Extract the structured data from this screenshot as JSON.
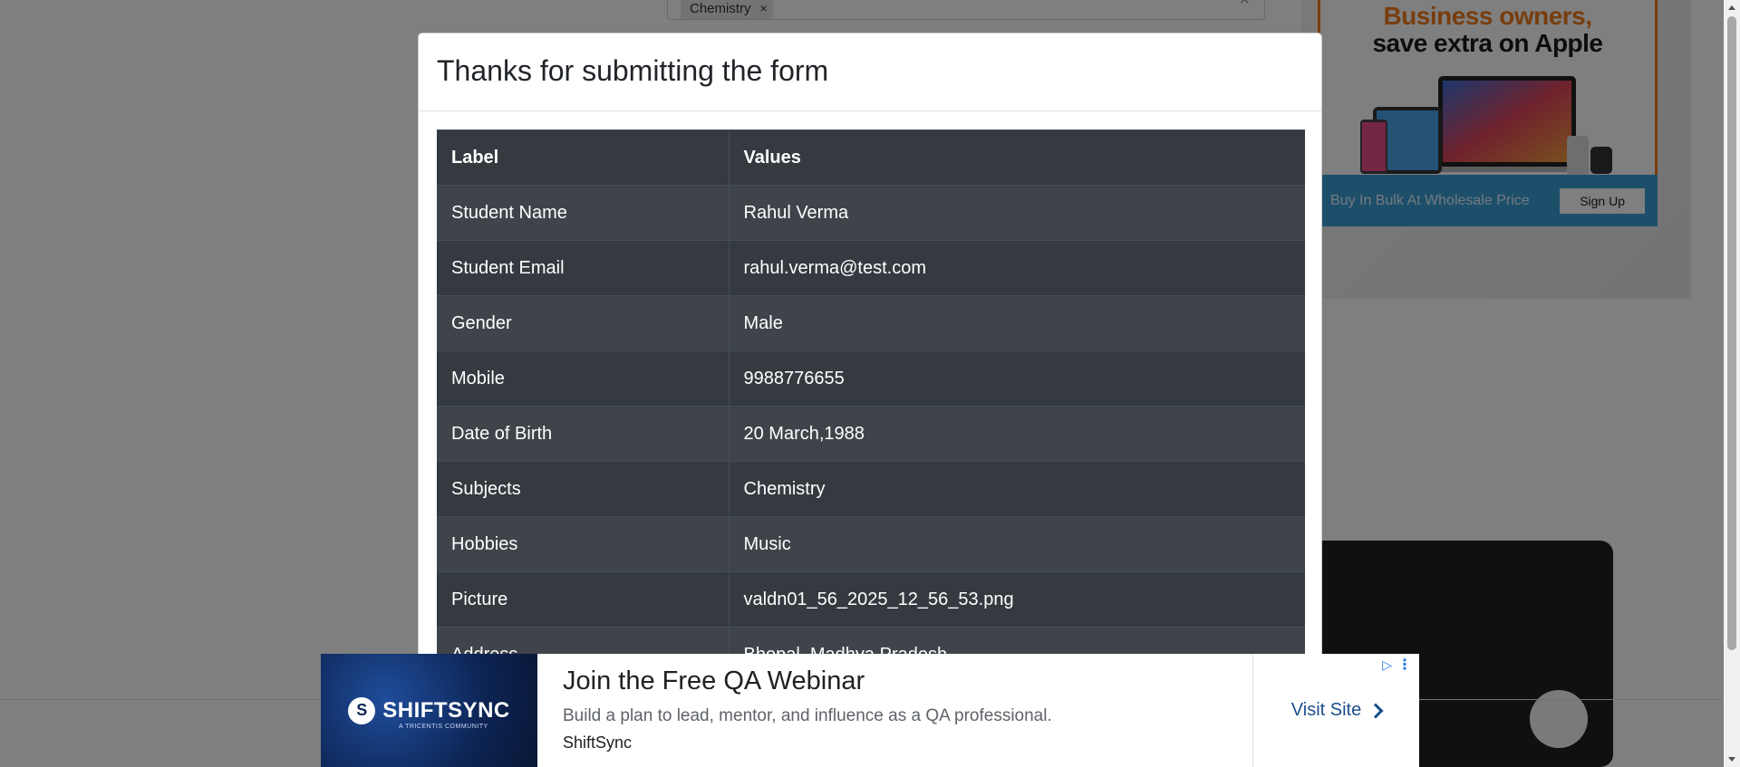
{
  "background": {
    "subjects_chip": "Chemistry",
    "chip_remove": "×",
    "field_clear": "×",
    "apple_ad": {
      "line1": "Business owners,",
      "line2": "save extra on Apple",
      "strip_text": "Buy In Bulk At Wholesale Price",
      "signup_label": "Sign Up"
    }
  },
  "modal": {
    "title": "Thanks for submitting the form",
    "table": {
      "headers": [
        "Label",
        "Values"
      ],
      "rows": [
        {
          "label": "Student Name",
          "value": "Rahul Verma"
        },
        {
          "label": "Student Email",
          "value": "rahul.verma@test.com"
        },
        {
          "label": "Gender",
          "value": "Male"
        },
        {
          "label": "Mobile",
          "value": "9988776655"
        },
        {
          "label": "Date of Birth",
          "value": "20 March,1988"
        },
        {
          "label": "Subjects",
          "value": "Chemistry"
        },
        {
          "label": "Hobbies",
          "value": "Music"
        },
        {
          "label": "Picture",
          "value": "valdn01_56_2025_12_56_53.png"
        },
        {
          "label": "Address",
          "value": "Bhopal, Madhya Pradesh"
        }
      ]
    }
  },
  "bottom_ad": {
    "logo_letter": "S",
    "logo_text": "SHIFTSYNC",
    "logo_subtext": "A TRICENTIS COMMUNITY",
    "headline": "Join the Free QA Webinar",
    "description": "Build a plan to lead, mentor, and influence as a QA professional.",
    "brand": "ShiftSync",
    "cta": "Visit Site",
    "adchoices_icon": "▷",
    "menu_icon": "⋮"
  },
  "colors": {
    "overlay": "rgba(0,0,0,0.5)",
    "table_dark": "#343a40",
    "table_stripe": "#3e444a",
    "apple_orange": "#f07a1a",
    "cta_blue": "#1a4e8c"
  }
}
